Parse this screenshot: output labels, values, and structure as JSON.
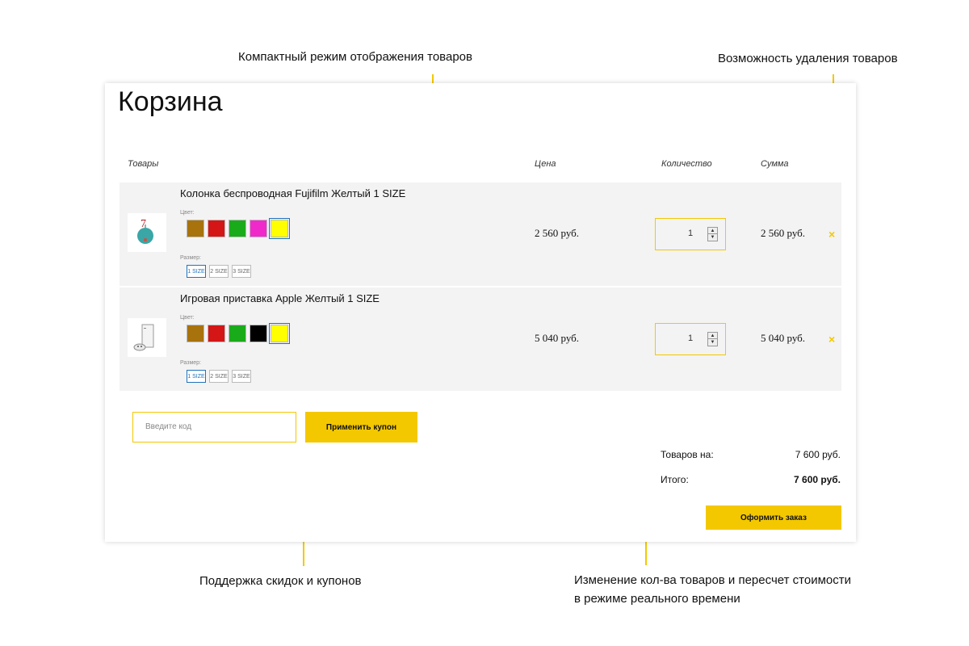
{
  "callouts": {
    "compact_mode": "Компактный режим отображения товаров",
    "delete_items": "Возможность удаления товаров",
    "coupons": "Поддержка скидок и купонов",
    "realtime_line1": "Изменение кол-ва товаров и пересчет стоимости",
    "realtime_line2": "в режиме реального времени"
  },
  "cart": {
    "title": "Корзина",
    "headers": {
      "products": "Товары",
      "price": "Цена",
      "quantity": "Количество",
      "sum": "Сумма"
    },
    "color_label": "Цвет:",
    "size_label": "Размер:",
    "size_options": [
      "1 SIZE",
      "2 SIZE",
      "3 SIZE"
    ],
    "items": [
      {
        "name": "Колонка беспроводная Fujifilm Желтый 1 SIZE",
        "price": "2 560 руб.",
        "quantity": "1",
        "sum": "2 560 руб.",
        "colors": [
          "#a8720c",
          "#d41616",
          "#1aab1a",
          "#f02aca",
          "#ffff00"
        ],
        "selected_color": 4,
        "selected_size": 0,
        "image_icon": "speaker-icon"
      },
      {
        "name": "Игровая приставка Apple Желтый 1 SIZE",
        "price": "5 040 руб.",
        "quantity": "1",
        "sum": "5 040 руб.",
        "colors": [
          "#a8720c",
          "#d41616",
          "#1aab1a",
          "#000000",
          "#ffff00"
        ],
        "selected_color": 4,
        "selected_size": 0,
        "image_icon": "console-icon"
      }
    ],
    "remove_glyph": "×",
    "qty_up": "▲",
    "qty_down": "▼",
    "coupon": {
      "placeholder": "Введите код",
      "button": "Применить купон"
    },
    "totals": {
      "subtotal_label": "Товаров на:",
      "subtotal_value": "7 600 руб.",
      "total_label": "Итого:",
      "total_value": "7 600 руб."
    },
    "checkout_button": "Оформить заказ"
  },
  "colors": {
    "accent": "#f3c800",
    "row_bg": "#f3f3f3",
    "selected_outline": "#1e73be"
  }
}
